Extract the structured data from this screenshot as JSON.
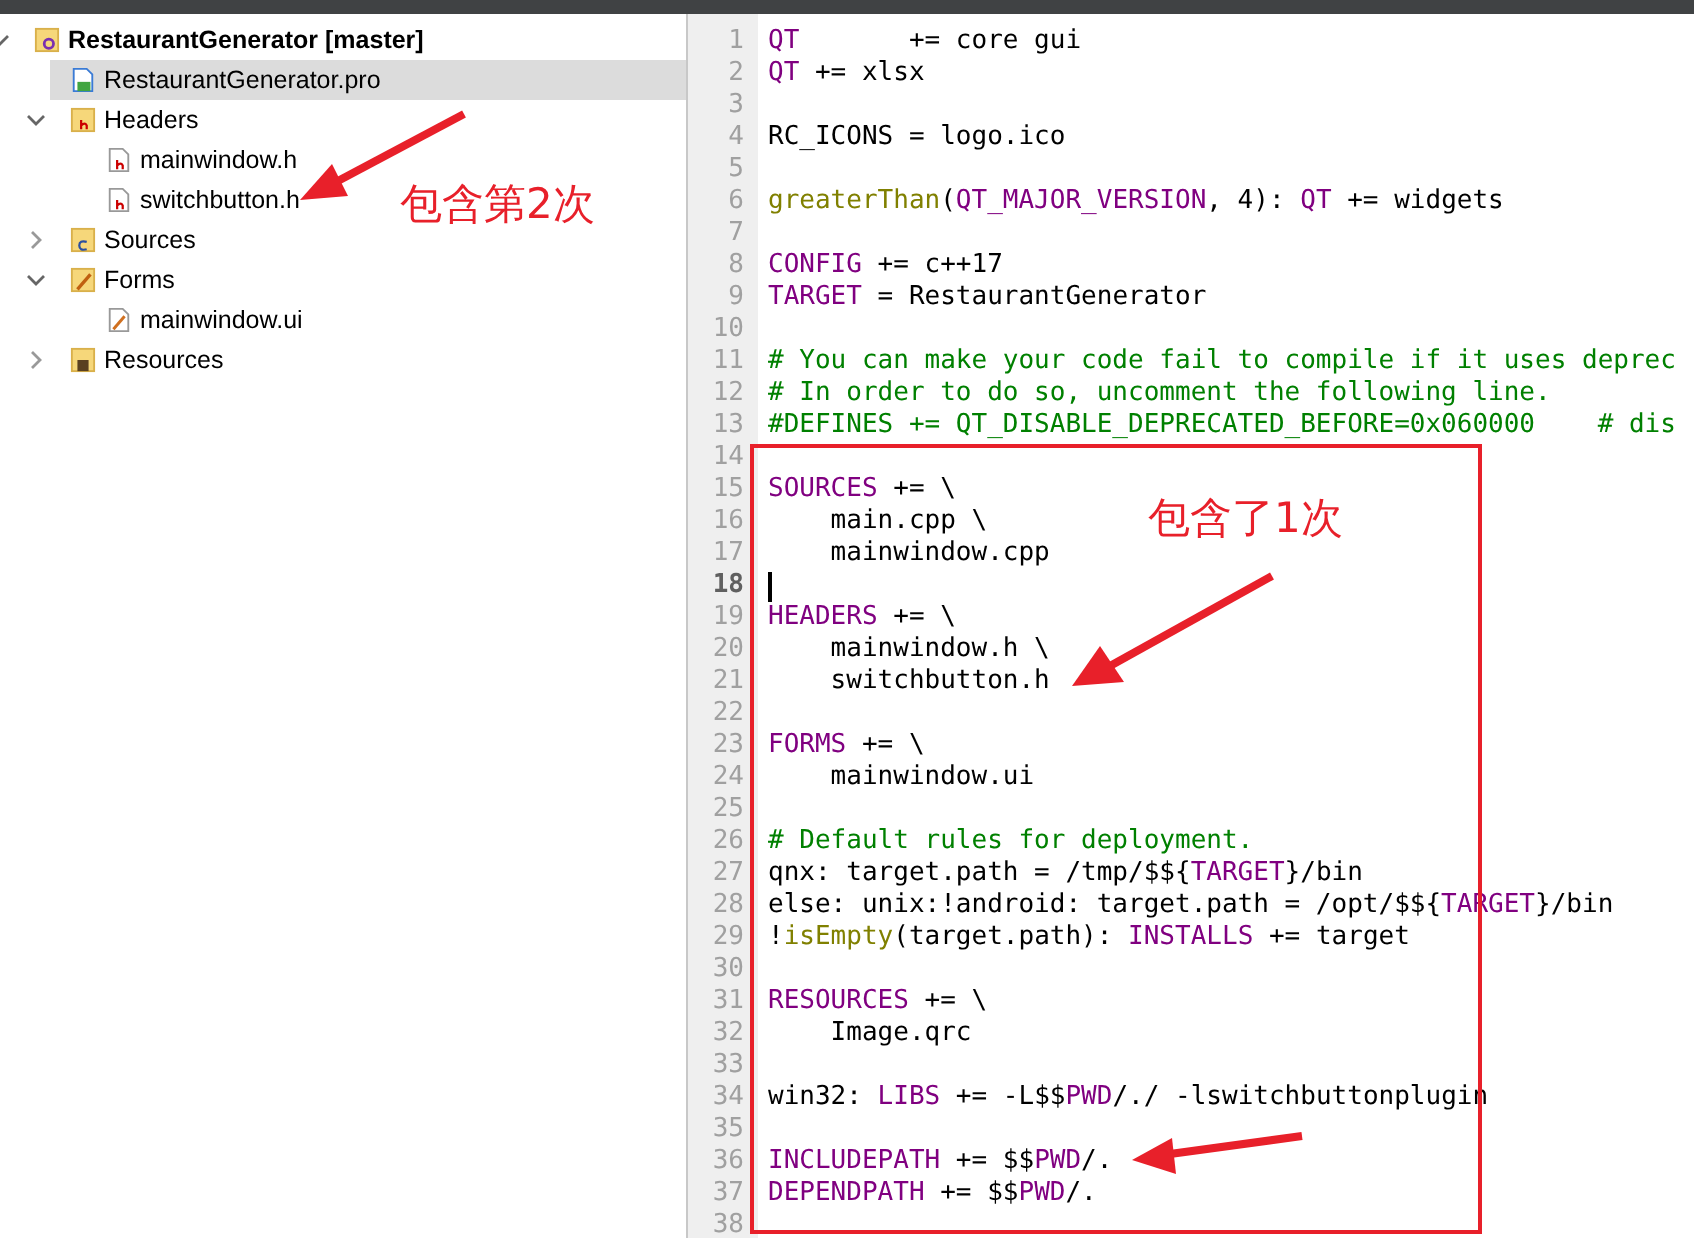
{
  "project_tree": [
    {
      "label": "RestaurantGenerator [master]",
      "kind": "project",
      "expanded": true,
      "selected": false,
      "children": [
        {
          "label": "RestaurantGenerator.pro",
          "kind": "pro",
          "selected": true
        },
        {
          "label": "Headers",
          "kind": "folder-h",
          "expanded": true,
          "selected": false,
          "children": [
            {
              "label": "mainwindow.h",
              "kind": "header",
              "selected": false
            },
            {
              "label": "switchbutton.h",
              "kind": "header",
              "selected": false
            }
          ]
        },
        {
          "label": "Sources",
          "kind": "folder-cpp",
          "expanded": false,
          "selected": false
        },
        {
          "label": "Forms",
          "kind": "folder-ui",
          "expanded": true,
          "selected": false,
          "children": [
            {
              "label": "mainwindow.ui",
              "kind": "ui",
              "selected": false
            }
          ]
        },
        {
          "label": "Resources",
          "kind": "folder-res",
          "expanded": false,
          "selected": false
        }
      ]
    }
  ],
  "editor": {
    "lines": [
      {
        "number": "1",
        "current": false,
        "tokens": [
          {
            "t": "QT",
            "kind": "kw"
          },
          {
            "t": "       += core gui"
          }
        ]
      },
      {
        "number": "2",
        "current": false,
        "tokens": [
          {
            "t": "QT",
            "kind": "kw"
          },
          {
            "t": " += xlsx"
          }
        ]
      },
      {
        "number": "3",
        "current": false
      },
      {
        "number": "4",
        "current": false,
        "tokens": [
          {
            "t": "RC_ICONS = logo.ico"
          }
        ]
      },
      {
        "number": "5",
        "current": false
      },
      {
        "number": "6",
        "current": false,
        "tokens": [
          {
            "t": "greaterThan",
            "kind": "fn"
          },
          {
            "t": "("
          },
          {
            "t": "QT_MAJOR_VERSION",
            "kind": "kw"
          },
          {
            "t": ", 4): "
          },
          {
            "t": "QT",
            "kind": "kw"
          },
          {
            "t": " += widgets"
          }
        ]
      },
      {
        "number": "7",
        "current": false
      },
      {
        "number": "8",
        "current": false,
        "tokens": [
          {
            "t": "CONFIG",
            "kind": "kw"
          },
          {
            "t": " += c++17"
          }
        ]
      },
      {
        "number": "9",
        "current": false,
        "tokens": [
          {
            "t": "TARGET",
            "kind": "kw"
          },
          {
            "t": " = RestaurantGenerator"
          }
        ]
      },
      {
        "number": "10",
        "current": false
      },
      {
        "number": "11",
        "current": false,
        "tokens": [
          {
            "t": "# You can make your code fail to compile if it uses deprec",
            "kind": "comment"
          }
        ]
      },
      {
        "number": "12",
        "current": false,
        "tokens": [
          {
            "t": "# In order to do so, uncomment the following line.",
            "kind": "comment"
          }
        ]
      },
      {
        "number": "13",
        "current": false,
        "tokens": [
          {
            "t": "#DEFINES += QT_DISABLE_DEPRECATED_BEFORE=0x060000    # dis",
            "kind": "comment"
          }
        ]
      },
      {
        "number": "14",
        "current": false
      },
      {
        "number": "15",
        "current": false,
        "tokens": [
          {
            "t": "SOURCES",
            "kind": "kw"
          },
          {
            "t": " += \\"
          }
        ]
      },
      {
        "number": "16",
        "current": false,
        "tokens": [
          {
            "t": "    main.cpp \\"
          }
        ]
      },
      {
        "number": "17",
        "current": false,
        "tokens": [
          {
            "t": "    mainwindow.cpp"
          }
        ]
      },
      {
        "number": "18",
        "current": true
      },
      {
        "number": "19",
        "current": false,
        "tokens": [
          {
            "t": "HEADERS",
            "kind": "kw"
          },
          {
            "t": " += \\"
          }
        ]
      },
      {
        "number": "20",
        "current": false,
        "tokens": [
          {
            "t": "    mainwindow.h \\"
          }
        ]
      },
      {
        "number": "21",
        "current": false,
        "tokens": [
          {
            "t": "    switchbutton.h"
          }
        ]
      },
      {
        "number": "22",
        "current": false
      },
      {
        "number": "23",
        "current": false,
        "tokens": [
          {
            "t": "FORMS",
            "kind": "kw"
          },
          {
            "t": " += \\"
          }
        ]
      },
      {
        "number": "24",
        "current": false,
        "tokens": [
          {
            "t": "    mainwindow.ui"
          }
        ]
      },
      {
        "number": "25",
        "current": false
      },
      {
        "number": "26",
        "current": false,
        "tokens": [
          {
            "t": "# Default rules for deployment.",
            "kind": "comment"
          }
        ]
      },
      {
        "number": "27",
        "current": false,
        "tokens": [
          {
            "t": "qnx: target.path = /tmp/$${"
          },
          {
            "t": "TARGET",
            "kind": "kw"
          },
          {
            "t": "}/bin"
          }
        ]
      },
      {
        "number": "28",
        "current": false,
        "tokens": [
          {
            "t": "else: unix:!android: target.path = /opt/$${"
          },
          {
            "t": "TARGET",
            "kind": "kw"
          },
          {
            "t": "}/bin"
          }
        ]
      },
      {
        "number": "29",
        "current": false,
        "tokens": [
          {
            "t": "!"
          },
          {
            "t": "isEmpty",
            "kind": "fn"
          },
          {
            "t": "(target.path): "
          },
          {
            "t": "INSTALLS",
            "kind": "kw"
          },
          {
            "t": " += target"
          }
        ]
      },
      {
        "number": "30",
        "current": false
      },
      {
        "number": "31",
        "current": false,
        "tokens": [
          {
            "t": "RESOURCES",
            "kind": "kw"
          },
          {
            "t": " += \\"
          }
        ]
      },
      {
        "number": "32",
        "current": false,
        "tokens": [
          {
            "t": "    Image.qrc"
          }
        ]
      },
      {
        "number": "33",
        "current": false
      },
      {
        "number": "34",
        "current": false,
        "tokens": [
          {
            "t": "win32: "
          },
          {
            "t": "LIBS",
            "kind": "kw"
          },
          {
            "t": " += -L$$"
          },
          {
            "t": "PWD",
            "kind": "kw"
          },
          {
            "t": "/./ -lswitchbuttonplugin"
          }
        ]
      },
      {
        "number": "35",
        "current": false
      },
      {
        "number": "36",
        "current": false,
        "tokens": [
          {
            "t": "INCLUDEPATH",
            "kind": "kw"
          },
          {
            "t": " += $$"
          },
          {
            "t": "PWD",
            "kind": "kw"
          },
          {
            "t": "/."
          }
        ]
      },
      {
        "number": "37",
        "current": false,
        "tokens": [
          {
            "t": "DEPENDPATH",
            "kind": "kw"
          },
          {
            "t": " += $$"
          },
          {
            "t": "PWD",
            "kind": "kw"
          },
          {
            "t": "/."
          }
        ]
      },
      {
        "number": "38",
        "current": false
      }
    ]
  },
  "annotations": [
    {
      "text": "包含第2次"
    },
    {
      "text": "包含了1次"
    }
  ]
}
